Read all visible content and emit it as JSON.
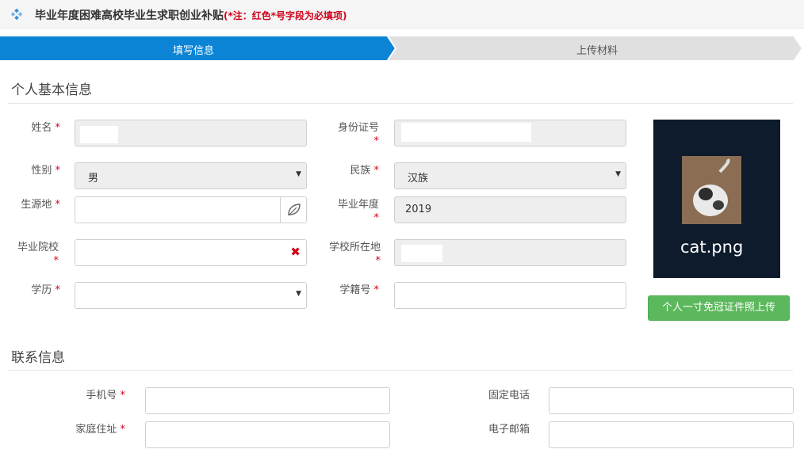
{
  "header": {
    "title": "毕业年度困难高校毕业生求职创业补贴",
    "note": "(*注：红色*号字段为必填项)",
    "icon": "diamond-cluster-icon"
  },
  "steps": [
    {
      "label": "填写信息",
      "active": true
    },
    {
      "label": "上传材料",
      "active": false
    }
  ],
  "colors": {
    "accent": "#0b84d6",
    "required": "#d0021b",
    "success": "#5cb85c"
  },
  "personal": {
    "section_title": "个人基本信息",
    "name": {
      "label": "姓名",
      "required": "*",
      "value": ""
    },
    "id_number": {
      "label": "身份证号",
      "required": "*",
      "value": ""
    },
    "gender": {
      "label": "性别",
      "required": "*",
      "value": "男"
    },
    "ethnicity": {
      "label": "民族",
      "required": "*",
      "value": "汉族"
    },
    "origin": {
      "label": "生源地",
      "required": "*",
      "value": ""
    },
    "grad_year": {
      "label": "毕业年度",
      "required": "*",
      "value": "2019"
    },
    "school": {
      "label": "毕业院校",
      "required": "*",
      "value": ""
    },
    "school_location": {
      "label": "学校所在地",
      "required": "*",
      "value": ""
    },
    "education": {
      "label": "学历",
      "required": "*",
      "value": ""
    },
    "student_no": {
      "label": "学籍号",
      "required": "*",
      "value": ""
    },
    "photo": {
      "filename": "cat.png",
      "upload_button": "个人一寸免冠证件照上传"
    }
  },
  "contact": {
    "section_title": "联系信息",
    "mobile": {
      "label": "手机号",
      "required": "*",
      "value": ""
    },
    "phone": {
      "label": "固定电话",
      "value": ""
    },
    "address": {
      "label": "家庭住址",
      "required": "*",
      "value": ""
    },
    "email": {
      "label": "电子邮箱",
      "value": ""
    }
  }
}
